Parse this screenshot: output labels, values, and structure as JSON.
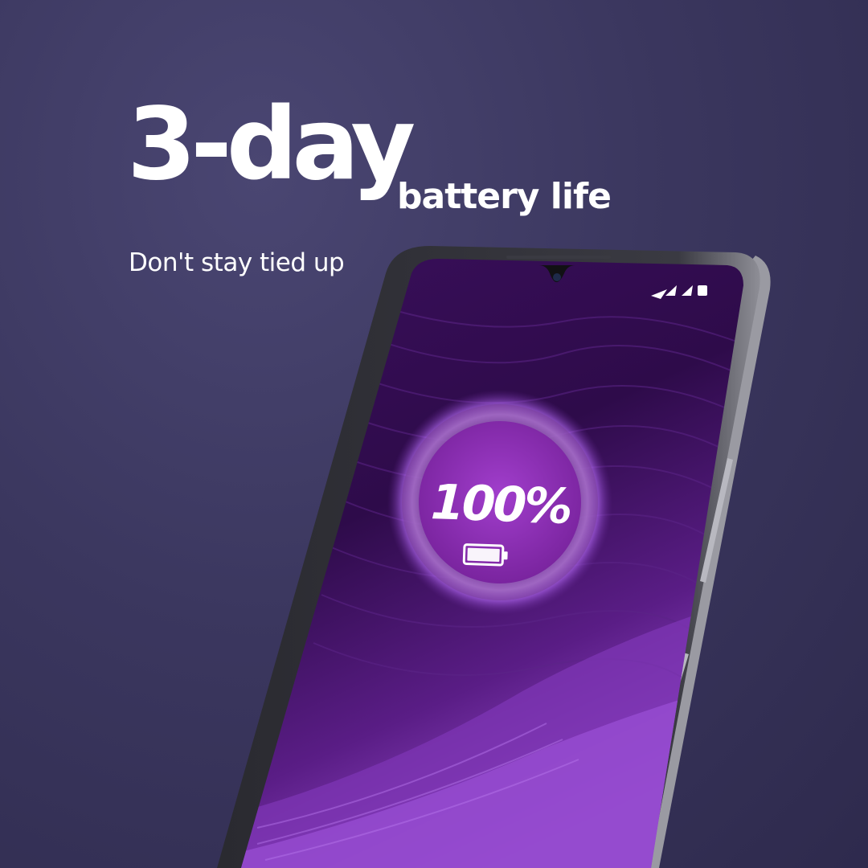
{
  "hero": {
    "headline": "3-day",
    "headline_sub": "battery life",
    "tagline": "Don't stay tied up"
  },
  "phone": {
    "battery_percent_label": "100%",
    "battery_level": 1.0,
    "status_icons": [
      "wifi-icon",
      "signal-icon",
      "signal-icon",
      "battery-icon"
    ],
    "screen_color": "#4a1670",
    "ring_glow_color": "#c98aff",
    "inner_disc_color": "#8a2fb3",
    "frame_color": "#1a1a1f"
  }
}
